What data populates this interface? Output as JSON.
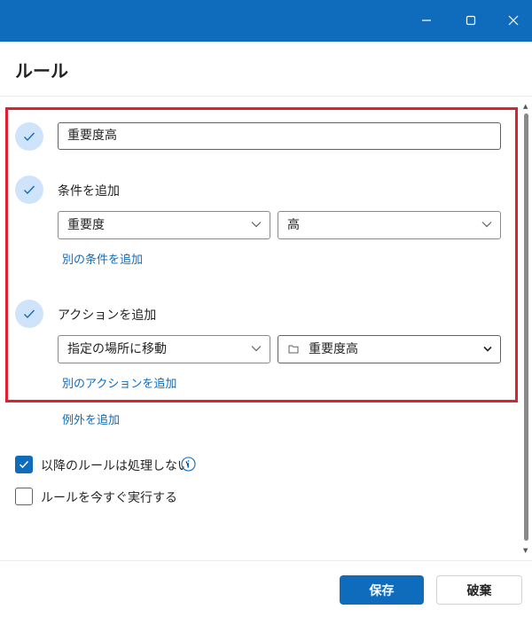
{
  "window": {
    "title_bar_color": "#0f6cbd",
    "controls": [
      "minimize-icon",
      "maximize-icon",
      "close-icon"
    ]
  },
  "dialog": {
    "title": "ルール"
  },
  "rule": {
    "name_value": "重要度高",
    "condition": {
      "heading": "条件を追加",
      "field": "重要度",
      "value": "高",
      "add_link": "別の条件を追加"
    },
    "action": {
      "heading": "アクションを追加",
      "type": "指定の場所に移動",
      "folder": "重要度高",
      "add_link": "別のアクションを追加"
    },
    "exception_link": "例外を追加"
  },
  "options": {
    "stop_processing": {
      "label": "以降のルールは処理しない",
      "checked": true
    },
    "run_now": {
      "label": "ルールを今すぐ実行する",
      "checked": false
    }
  },
  "footer": {
    "save_label": "保存",
    "discard_label": "破棄"
  },
  "colors": {
    "accent": "#0f6cbd",
    "highlight_frame": "#e02030",
    "step_circle": "#cfe4fa"
  }
}
